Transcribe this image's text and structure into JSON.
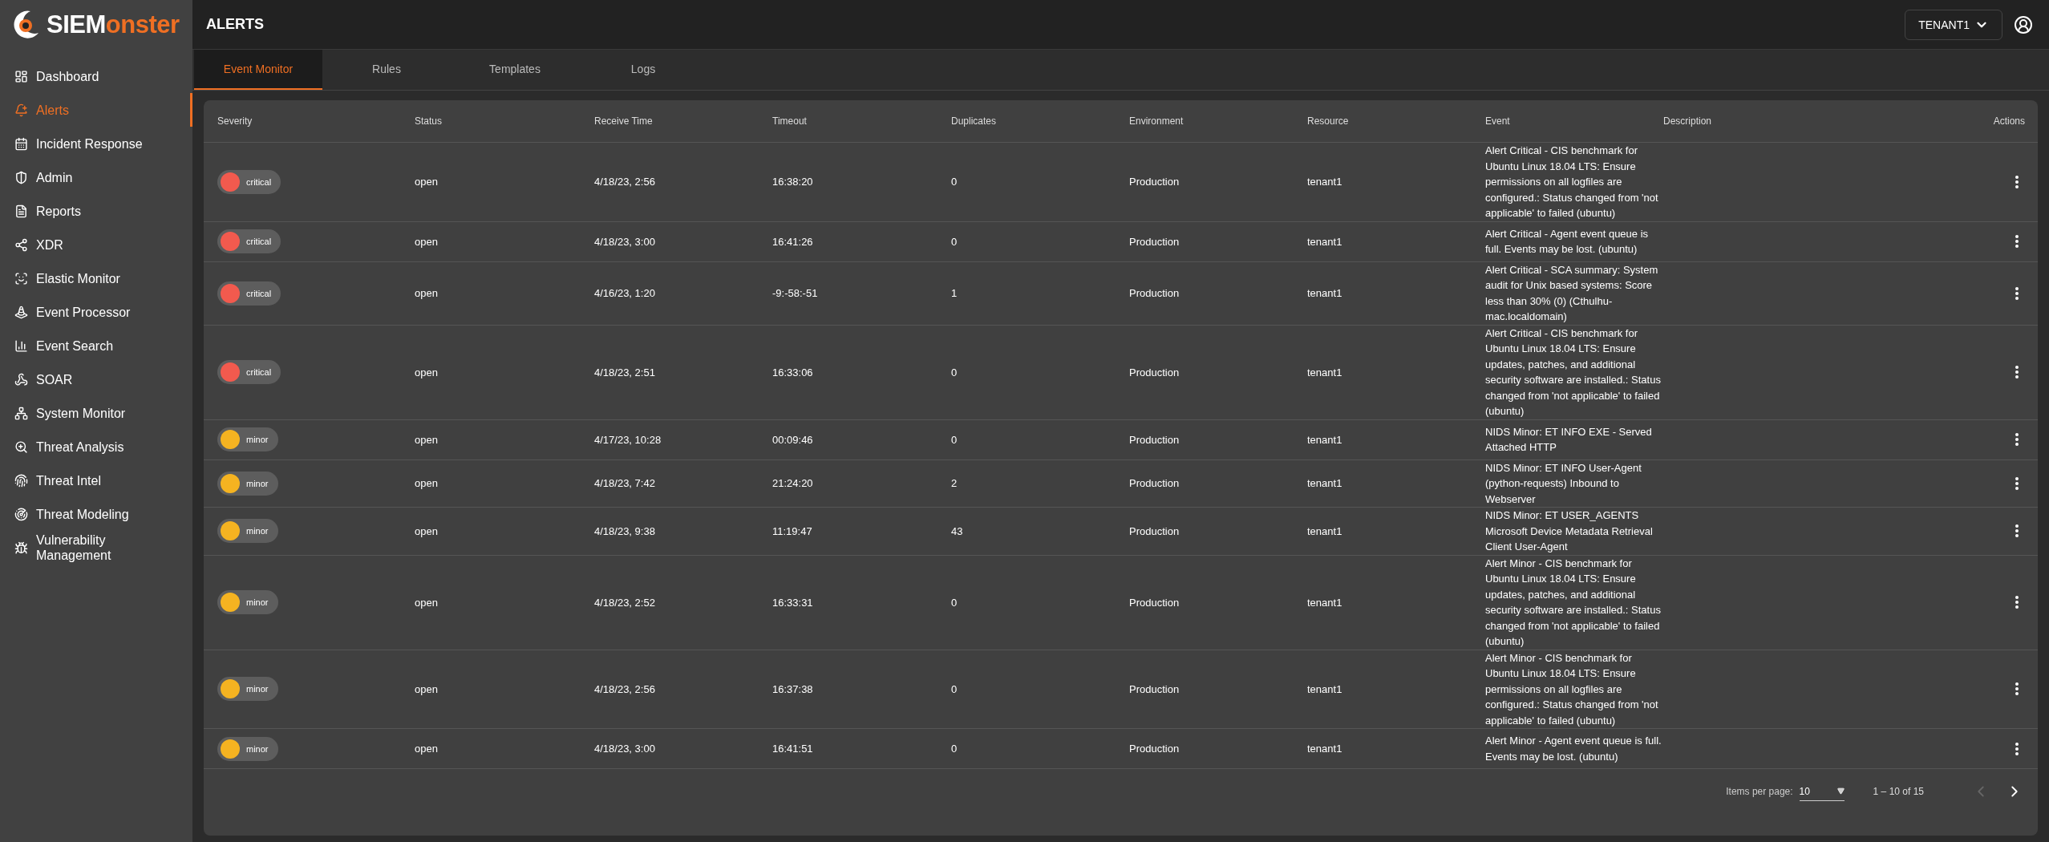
{
  "logo": {
    "word_light": "SIEM",
    "word_accent": "onster"
  },
  "sidebar": {
    "items": [
      {
        "label": "Dashboard",
        "selected": false
      },
      {
        "label": "Alerts",
        "selected": true
      },
      {
        "label": "Incident Response",
        "selected": false
      },
      {
        "label": "Admin",
        "selected": false
      },
      {
        "label": "Reports",
        "selected": false
      },
      {
        "label": "XDR",
        "selected": false
      },
      {
        "label": "Elastic Monitor",
        "selected": false
      },
      {
        "label": "Event Processor",
        "selected": false
      },
      {
        "label": "Event Search",
        "selected": false
      },
      {
        "label": "SOAR",
        "selected": false
      },
      {
        "label": "System Monitor",
        "selected": false
      },
      {
        "label": "Threat Analysis",
        "selected": false
      },
      {
        "label": "Threat Intel",
        "selected": false
      },
      {
        "label": "Threat Modeling",
        "selected": false
      },
      {
        "label": "Vulnerability Management",
        "selected": false
      }
    ]
  },
  "header": {
    "title": "ALERTS",
    "tenant": "TENANT1"
  },
  "tabs": [
    {
      "label": "Event Monitor",
      "selected": true
    },
    {
      "label": "Rules",
      "selected": false
    },
    {
      "label": "Templates",
      "selected": false
    },
    {
      "label": "Logs",
      "selected": false
    }
  ],
  "table": {
    "columns": [
      "Severity",
      "Status",
      "Receive Time",
      "Timeout",
      "Duplicates",
      "Environment",
      "Resource",
      "Event",
      "Description",
      "Actions"
    ],
    "rows": [
      {
        "severity": "critical",
        "color": "#f25a4e",
        "status": "open",
        "receive_time": "4/18/23, 2:56",
        "timeout": "16:38:20",
        "duplicates": "0",
        "environment": "Production",
        "resource": "tenant1",
        "event": "Alert Critical - CIS benchmark for Ubuntu Linux 18.04 LTS: Ensure permissions on all logfiles are configured.: Status changed from 'not applicable' to failed (ubuntu)"
      },
      {
        "severity": "critical",
        "color": "#f25a4e",
        "status": "open",
        "receive_time": "4/18/23, 3:00",
        "timeout": "16:41:26",
        "duplicates": "0",
        "environment": "Production",
        "resource": "tenant1",
        "event": "Alert Critical - Agent event queue is full. Events may be lost. (ubuntu)"
      },
      {
        "severity": "critical",
        "color": "#f25a4e",
        "status": "open",
        "receive_time": "4/16/23, 1:20",
        "timeout": "-9:-58:-51",
        "duplicates": "1",
        "environment": "Production",
        "resource": "tenant1",
        "event": "Alert Critical - SCA summary: System audit for Unix based systems: Score less than 30% (0) (Cthulhu-mac.localdomain)"
      },
      {
        "severity": "critical",
        "color": "#f25a4e",
        "status": "open",
        "receive_time": "4/18/23, 2:51",
        "timeout": "16:33:06",
        "duplicates": "0",
        "environment": "Production",
        "resource": "tenant1",
        "event": "Alert Critical - CIS benchmark for Ubuntu Linux 18.04 LTS: Ensure updates, patches, and additional security software are installed.: Status changed from 'not applicable' to failed (ubuntu)"
      },
      {
        "severity": "minor",
        "color": "#f5b321",
        "status": "open",
        "receive_time": "4/17/23, 10:28",
        "timeout": "00:09:46",
        "duplicates": "0",
        "environment": "Production",
        "resource": "tenant1",
        "event": "NIDS Minor: ET INFO EXE - Served Attached HTTP"
      },
      {
        "severity": "minor",
        "color": "#f5b321",
        "status": "open",
        "receive_time": "4/18/23, 7:42",
        "timeout": "21:24:20",
        "duplicates": "2",
        "environment": "Production",
        "resource": "tenant1",
        "event": "NIDS Minor: ET INFO User-Agent (python-requests) Inbound to Webserver"
      },
      {
        "severity": "minor",
        "color": "#f5b321",
        "status": "open",
        "receive_time": "4/18/23, 9:38",
        "timeout": "11:19:47",
        "duplicates": "43",
        "environment": "Production",
        "resource": "tenant1",
        "event": "NIDS Minor: ET USER_AGENTS Microsoft Device Metadata Retrieval Client User-Agent"
      },
      {
        "severity": "minor",
        "color": "#f5b321",
        "status": "open",
        "receive_time": "4/18/23, 2:52",
        "timeout": "16:33:31",
        "duplicates": "0",
        "environment": "Production",
        "resource": "tenant1",
        "event": "Alert Minor - CIS benchmark for Ubuntu Linux 18.04 LTS: Ensure updates, patches, and additional security software are installed.: Status changed from 'not applicable' to failed (ubuntu)"
      },
      {
        "severity": "minor",
        "color": "#f5b321",
        "status": "open",
        "receive_time": "4/18/23, 2:56",
        "timeout": "16:37:38",
        "duplicates": "0",
        "environment": "Production",
        "resource": "tenant1",
        "event": "Alert Minor - CIS benchmark for Ubuntu Linux 18.04 LTS: Ensure permissions on all logfiles are configured.: Status changed from 'not applicable' to failed (ubuntu)"
      },
      {
        "severity": "minor",
        "color": "#f5b321",
        "status": "open",
        "receive_time": "4/18/23, 3:00",
        "timeout": "16:41:51",
        "duplicates": "0",
        "environment": "Production",
        "resource": "tenant1",
        "event": "Alert Minor - Agent event queue is full. Events may be lost. (ubuntu)"
      }
    ]
  },
  "pagination": {
    "label": "Items per page:",
    "page_size": "10",
    "range": "1 – 10 of 15",
    "prev_disabled": true,
    "next_disabled": false
  }
}
